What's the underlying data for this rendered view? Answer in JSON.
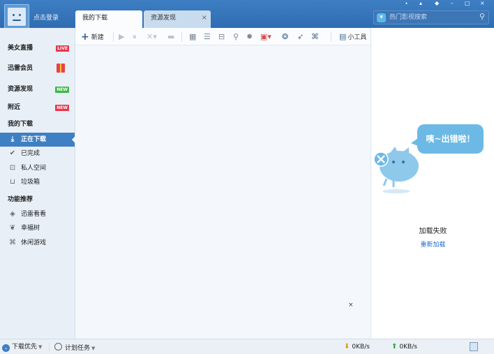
{
  "header": {
    "login_text": "点击登录",
    "tabs": [
      {
        "label": "我的下载",
        "active": true
      },
      {
        "label": "资源发现",
        "active": false,
        "close": "×"
      }
    ],
    "search_placeholder": "热门影视搜索",
    "window_controls": [
      "⬩",
      "▴",
      "◆",
      "–",
      "□",
      "×"
    ]
  },
  "sidebar": {
    "items": [
      {
        "label": "美女直播",
        "badge": "LIVE"
      },
      {
        "label": "迅雷会员",
        "badge": "gift"
      },
      {
        "label": "资源发现",
        "badge": "NEW"
      },
      {
        "label": "附近",
        "badge": "NEW"
      }
    ],
    "section_downloads": "我的下载",
    "downloads": [
      {
        "label": "正在下载",
        "icon": "download-icon",
        "selected": true
      },
      {
        "label": "已完成",
        "icon": "check-icon"
      },
      {
        "label": "私人空间",
        "icon": "lock-icon"
      },
      {
        "label": "垃圾箱",
        "icon": "trash-icon"
      }
    ],
    "section_features": "功能推荐",
    "features": [
      {
        "label": "迅雷看看",
        "icon": "shield-icon"
      },
      {
        "label": "幸福树",
        "icon": "leaf-icon"
      },
      {
        "label": "休闲游戏",
        "icon": "gamepad-icon"
      }
    ]
  },
  "toolbar": {
    "new_label": "新建",
    "tools_label": "小工具"
  },
  "main": {
    "close_mark": "×"
  },
  "error_panel": {
    "bubble_text": "咦~出错啦！",
    "title": "加载失败",
    "reload_link": "重新加载"
  },
  "statusbar": {
    "priority_label": "下载优先",
    "schedule_label": "计划任务",
    "down_speed": "0KB/s",
    "up_speed": "0KB/s"
  },
  "colors": {
    "accent": "#3f7fc4",
    "header": "#2f6db2",
    "link": "#1f6fc6",
    "bubble": "#6cb9e5"
  }
}
